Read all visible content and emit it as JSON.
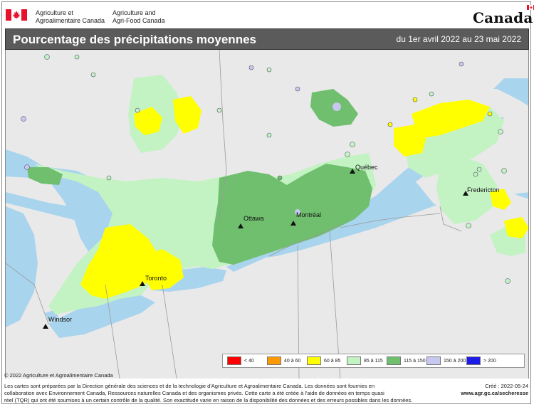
{
  "header": {
    "dept_fr_line1": "Agriculture et",
    "dept_fr_line2": "Agroalimentaire Canada",
    "dept_en_line1": "Agriculture and",
    "dept_en_line2": "Agri-Food Canada",
    "wordmark": "Canada",
    "flag_red": "#e8112d"
  },
  "title_bar": {
    "title": "Pourcentage des précipitations moyennes",
    "period": "du 1er avril 2022 au 23 mai 2022",
    "background": "#5b5b5b"
  },
  "map": {
    "colors": {
      "water": "#a9d4ee",
      "land": "#e9e9e9",
      "lt40": "#ff0000",
      "c40_60": "#ff9900",
      "c60_85": "#ffff00",
      "c85_115": "#c3f2c3",
      "c115_150": "#6fbf6f",
      "c150_200": "#c7c7f0",
      "gt200": "#1c1ce6"
    },
    "cities": [
      {
        "name": "Québec"
      },
      {
        "name": "Fredericton"
      },
      {
        "name": "Ottawa"
      },
      {
        "name": "Montréal"
      },
      {
        "name": "Toronto"
      },
      {
        "name": "Windsor"
      }
    ]
  },
  "legend": [
    {
      "label": "< 40",
      "color": "#ff0000"
    },
    {
      "label": "40 à 60",
      "color": "#ff9900"
    },
    {
      "label": "60 à 85",
      "color": "#ffff00"
    },
    {
      "label": "85 à 115",
      "color": "#c3f2c3"
    },
    {
      "label": "115 à 150",
      "color": "#6fbf6f"
    },
    {
      "label": "150 à 200",
      "color": "#c7c7f0"
    },
    {
      "label": "> 200",
      "color": "#1c1ce6"
    }
  ],
  "footer": {
    "copyright": "© 2022 Agriculture et Agroalimentaire Canada",
    "note_line1": "Les cartes sont préparées par la Direction générale des sciences et de la technologie d'Agriculture et Agroalimentaire Canada. Les données sont fournies en",
    "note_line2": "collaboration avec Environnement Canada, Ressources naturelles Canada et des organismes privés. Cette carte a été créée à l'aide de données en temps quasi",
    "note_line3": "réel (TQR) qui ont été soumises à un certain contrôle de la qualité. Son exactitude varie en raison de la disponibilité des données et des erreurs possibles dans les données.",
    "created": "Créé : 2022-05-24",
    "url": "www.agr.gc.ca/secheresse"
  }
}
